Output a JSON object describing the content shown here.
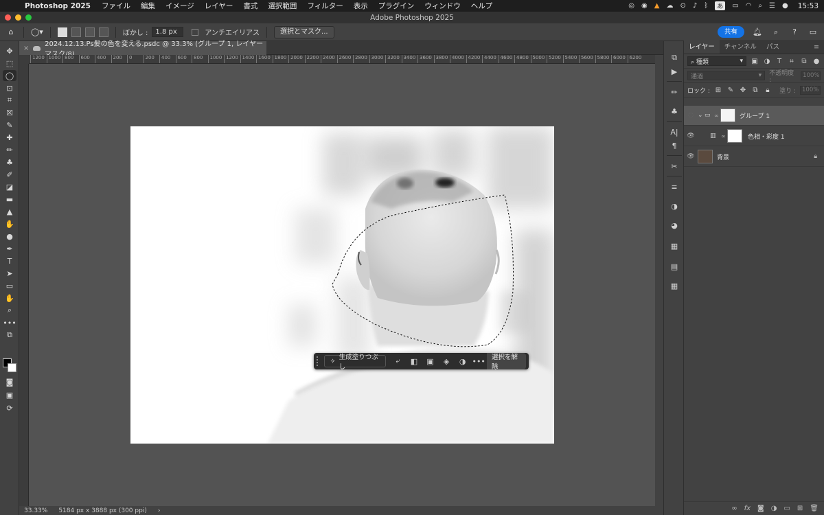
{
  "menubar": {
    "app_name": "Photoshop 2025",
    "items": [
      "ファイル",
      "編集",
      "イメージ",
      "レイヤー",
      "書式",
      "選択範囲",
      "フィルター",
      "表示",
      "プラグイン",
      "ウィンドウ",
      "ヘルプ"
    ],
    "ime": "あ",
    "clock": "15:53"
  },
  "window": {
    "title": "Adobe Photoshop 2025"
  },
  "options": {
    "feather_label": "ぼかし :",
    "feather_value": "1.8 px",
    "antialias_label": "アンチエイリアス",
    "select_mask_label": "選択とマスク...",
    "share_label": "共有"
  },
  "document": {
    "tab_title": "2024.12.13.Ps髪の色を変える.psdc @ 33.3% (グループ 1, レイヤーマスク/8)",
    "ruler_ticks": [
      "1200",
      "1000",
      "800",
      "600",
      "400",
      "200",
      "0",
      "200",
      "400",
      "600",
      "800",
      "1000",
      "1200",
      "1400",
      "1600",
      "1800",
      "2000",
      "2200",
      "2400",
      "2600",
      "2800",
      "3000",
      "3200",
      "3400",
      "3600",
      "3800",
      "4000",
      "4200",
      "4400",
      "4600",
      "4800",
      "5000",
      "5200",
      "5400",
      "5600",
      "5800",
      "6000",
      "6200"
    ]
  },
  "status": {
    "zoom": "33.33%",
    "doc_info": "5184 px x 3888 px (300 ppi)"
  },
  "contextbar": {
    "generative_fill": "生成塗りつぶし",
    "more": "•••",
    "deselect": "選択を解除"
  },
  "layers_panel": {
    "tabs": [
      "レイヤー",
      "チャンネル",
      "パス"
    ],
    "filter_label": "種類",
    "blend_mode": "通過",
    "opacity_label": "不透明度 :",
    "opacity_value": "100%",
    "lock_label": "ロック :",
    "fill_label": "塗り :",
    "fill_value": "100%",
    "layers": [
      {
        "name": "グループ 1"
      },
      {
        "name": "色相・彩度 1"
      },
      {
        "name": "背景"
      }
    ]
  },
  "colors": {
    "accent": "#1473e6",
    "panel_bg": "#424242",
    "canvas_bg": "#535353"
  }
}
